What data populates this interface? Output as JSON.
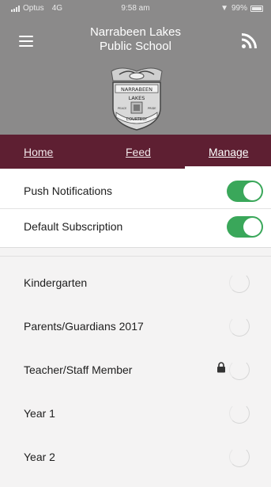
{
  "status_bar": {
    "carrier": "Optus",
    "network": "4G",
    "time": "9:58 am",
    "battery": "99%"
  },
  "header": {
    "school_name_line1": "Narrabeen Lakes",
    "school_name_line2": "Public School",
    "crest_top_text": "NARRABEEN",
    "crest_mid_text": "LAKES",
    "crest_bottom_text": "COURTESY",
    "crest_left_text": "PEACE",
    "crest_right_text": "PRIDE",
    "menu_icon": "hamburger-icon",
    "rss_icon": "rss-icon",
    "background": "#8b8a8a"
  },
  "tabs": {
    "items": [
      {
        "label": "Home"
      },
      {
        "label": "Feed"
      },
      {
        "label": "Manage",
        "active": true
      }
    ],
    "background": "#5e1f32"
  },
  "settings": {
    "items": [
      {
        "label": "Push Notifications",
        "enabled": true
      },
      {
        "label": "Default Subscription",
        "enabled": true
      }
    ],
    "toggle_color": "#3aa75a"
  },
  "groups": {
    "items": [
      {
        "label": "Kindergarten",
        "locked": false
      },
      {
        "label": "Parents/Guardians 2017",
        "locked": false
      },
      {
        "label": "Teacher/Staff Member",
        "locked": true
      },
      {
        "label": "Year 1",
        "locked": false
      },
      {
        "label": "Year 2",
        "locked": false
      }
    ]
  }
}
